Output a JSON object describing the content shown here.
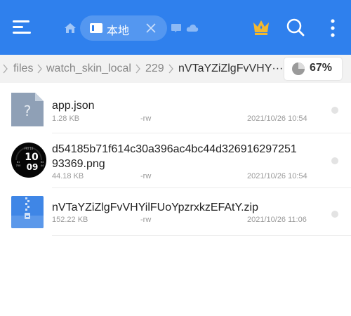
{
  "header": {
    "tab_local_label": "本地",
    "icons": [
      "menu-icon",
      "home-icon",
      "drive-icon",
      "close-icon",
      "image-tab-icon",
      "cloud-tab-icon",
      "crown-icon",
      "search-icon",
      "more-vertical-icon"
    ]
  },
  "breadcrumb": {
    "items": [
      "files",
      "watch_skin_local",
      "229",
      "nVTaYZiZlgFvVHY···"
    ],
    "storage_percent": "67%"
  },
  "files": [
    {
      "name": "app.json",
      "size": "1.28 KB",
      "perm": "-rw",
      "date": "2021/10/26 10:54",
      "icon": "unknown-file-icon"
    },
    {
      "name_line1": "d54185b71f614c30a396ac4bc44d326916297251",
      "name_line2": "93369.png",
      "size": "44.18 KB",
      "perm": "-rw",
      "date": "2021/10/26 10:54",
      "icon": "watch-face-thumbnail",
      "thumb": {
        "top": "FRI 10",
        "big1": "10",
        "big2": "09",
        "left1": "81",
        "left2": "750",
        "right1": "64",
        "right2": "44"
      }
    },
    {
      "name": "nVTaYZiZlgFvVHYilFUoYpzrxkzEFAtY.zip",
      "size": "152.22 KB",
      "perm": "-rw",
      "date": "2021/10/26 11:06",
      "icon": "zip-file-icon"
    }
  ],
  "colors": {
    "accent": "#2f80ed",
    "crown": "#f2b830"
  }
}
